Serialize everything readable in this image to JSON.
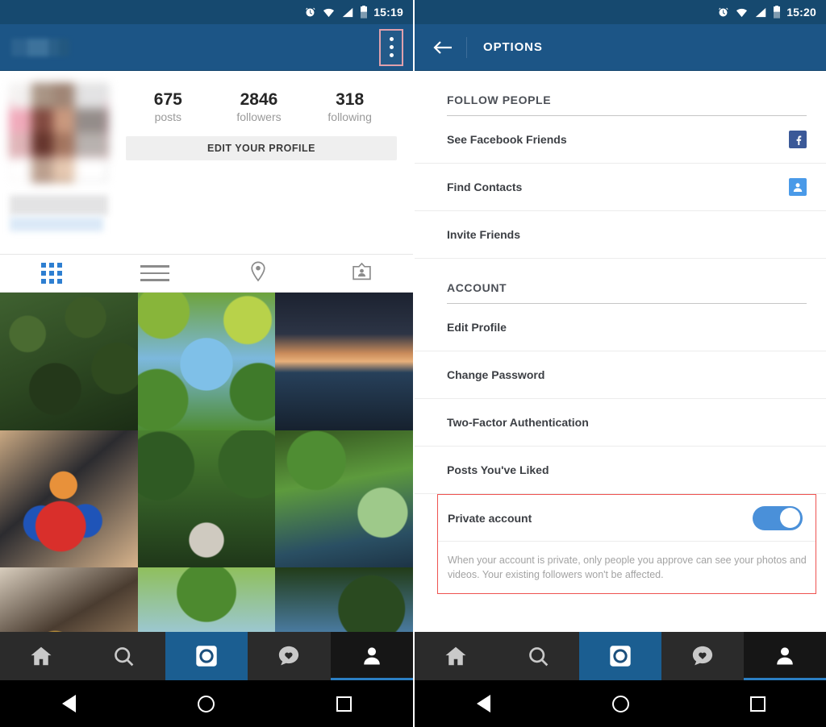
{
  "left": {
    "status": {
      "time": "15:19",
      "icons": [
        "alarm-icon",
        "wifi-icon",
        "signal-icon",
        "battery-icon"
      ]
    },
    "appbar": {
      "username_masked": "",
      "overflow_label": "More options"
    },
    "profile": {
      "stats": [
        {
          "value": "675",
          "label": "posts"
        },
        {
          "value": "2846",
          "label": "followers"
        },
        {
          "value": "318",
          "label": "following"
        }
      ],
      "edit_button": "EDIT YOUR PROFILE"
    },
    "tabs": [
      {
        "name": "grid-view",
        "icon": "grid-icon",
        "active": true
      },
      {
        "name": "list-view",
        "icon": "list-icon",
        "active": false
      },
      {
        "name": "photo-map",
        "icon": "location-pin-icon",
        "active": false
      },
      {
        "name": "tagged",
        "icon": "tagged-photos-icon",
        "active": false
      }
    ],
    "photos": [
      {
        "alt": "green trees along canal with bicycle"
      },
      {
        "alt": "blue sky through tree canopy"
      },
      {
        "alt": "city skyline at sunset over river"
      },
      {
        "alt": "colourful toy owl on desk with laptop"
      },
      {
        "alt": "tree lined pathway in park"
      },
      {
        "alt": "willow tree over lake"
      },
      {
        "alt": "hand holding a medal"
      },
      {
        "alt": "branches against blue sky"
      },
      {
        "alt": "trees silhouetted at dusk"
      }
    ]
  },
  "right": {
    "status": {
      "time": "15:20",
      "icons": [
        "alarm-icon",
        "wifi-icon",
        "signal-icon",
        "battery-icon"
      ]
    },
    "appbar": {
      "title": "OPTIONS",
      "back_icon": "back-arrow-icon"
    },
    "sections": [
      {
        "title": "FOLLOW PEOPLE",
        "items": [
          {
            "label": "See Facebook Friends",
            "icon": "facebook-icon"
          },
          {
            "label": "Find Contacts",
            "icon": "contacts-icon"
          },
          {
            "label": "Invite Friends",
            "icon": null
          }
        ]
      },
      {
        "title": "ACCOUNT",
        "items": [
          {
            "label": "Edit Profile",
            "icon": null
          },
          {
            "label": "Change Password",
            "icon": null
          },
          {
            "label": "Two-Factor Authentication",
            "icon": null
          },
          {
            "label": "Posts You've Liked",
            "icon": null
          }
        ]
      }
    ],
    "private": {
      "label": "Private account",
      "toggle_on": true,
      "description": "When your account is private, only people you approve can see your photos and videos. Your existing followers won't be affected."
    }
  },
  "bottom_nav": [
    {
      "name": "home",
      "icon": "home-icon"
    },
    {
      "name": "search",
      "icon": "search-icon"
    },
    {
      "name": "camera",
      "icon": "camera-icon"
    },
    {
      "name": "activity",
      "icon": "heart-activity-icon"
    },
    {
      "name": "profile",
      "icon": "person-icon"
    }
  ],
  "system_nav": [
    {
      "name": "back",
      "icon": "back-triangle-icon"
    },
    {
      "name": "home",
      "icon": "home-circle-icon"
    },
    {
      "name": "recent",
      "icon": "recents-square-icon"
    }
  ],
  "colors": {
    "appbar_blue": "#1c5586",
    "statusbar_blue": "#16496f",
    "accent_blue": "#2e7fd1",
    "toggle_blue": "#4a90d9",
    "highlight_red": "#ef5350",
    "facebook_blue": "#3b5998"
  }
}
